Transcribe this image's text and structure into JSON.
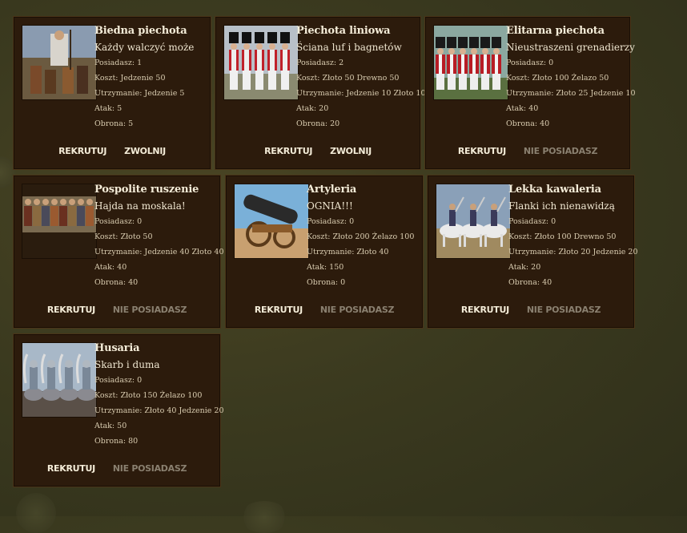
{
  "units": [
    {
      "name": "Biedna piechota",
      "motto": "Każdy walczyć może",
      "owned": "Posiadasz: 1",
      "cost": "Koszt: Jedzenie 50",
      "upkeep": "Utrzymanie: Jedzenie 5",
      "attack": "Atak: 5",
      "defense": "Obrona: 5",
      "recruit": "REKRUTUJ",
      "second": "ZWOLNIJ",
      "second_enabled": true,
      "image": "peasant-infantry"
    },
    {
      "name": "Piechota liniowa",
      "motto": "Ściana luf i bagnetów",
      "owned": "Posiadasz: 2",
      "cost": "Koszt: Złoto 50 Drewno 50",
      "upkeep": "Utrzymanie: Jedzenie 10 Złoto 10",
      "attack": "Atak: 20",
      "defense": "Obrona: 20",
      "recruit": "REKRUTUJ",
      "second": "ZWOLNIJ",
      "second_enabled": true,
      "image": "line-infantry"
    },
    {
      "name": "Elitarna piechota",
      "motto": "Nieustraszeni grenadierzy",
      "owned": "Posiadasz: 0",
      "cost": "Koszt: Złoto 100 Żelazo 50",
      "upkeep": "Utrzymanie: Złoto 25 Jedzenie 10",
      "attack": "Atak: 40",
      "defense": "Obrona: 40",
      "recruit": "REKRUTUJ",
      "second": "NIE POSIADASZ",
      "second_enabled": false,
      "image": "grenadiers"
    },
    {
      "name": "Pospolite ruszenie",
      "motto": "Hajda na moskala!",
      "owned": "Posiadasz: 0",
      "cost": "Koszt: Złoto 50",
      "upkeep": "Utrzymanie: Jedzenie 40 Złoto 40",
      "attack": "Atak: 40",
      "defense": "Obrona: 40",
      "recruit": "REKRUTUJ",
      "second": "NIE POSIADASZ",
      "second_enabled": false,
      "image": "levy"
    },
    {
      "name": "Artyleria",
      "motto": "OGNIA!!!",
      "owned": "Posiadasz: 0",
      "cost": "Koszt: Złoto 200 Żelazo 100",
      "upkeep": "Utrzymanie: Złoto 40",
      "attack": "Atak: 150",
      "defense": "Obrona: 0",
      "recruit": "REKRUTUJ",
      "second": "NIE POSIADASZ",
      "second_enabled": false,
      "image": "cannon"
    },
    {
      "name": "Lekka kawaleria",
      "motto": "Flanki ich nienawidzą",
      "owned": "Posiadasz: 0",
      "cost": "Koszt: Złoto 100 Drewno 50",
      "upkeep": "Utrzymanie: Złoto 20 Jedzenie 20",
      "attack": "Atak: 20",
      "defense": "Obrona: 40",
      "recruit": "REKRUTUJ",
      "second": "NIE POSIADASZ",
      "second_enabled": false,
      "image": "light-cavalry"
    },
    {
      "name": "Husaria",
      "motto": "Skarb i duma",
      "owned": "Posiadasz: 0",
      "cost": "Koszt: Złoto 150 Żelazo 100",
      "upkeep": "Utrzymanie: Złoto 40 Jedzenie 20",
      "attack": "Atak: 50",
      "defense": "Obrona: 80",
      "recruit": "REKRUTUJ",
      "second": "NIE POSIADASZ",
      "second_enabled": false,
      "image": "hussars"
    }
  ]
}
